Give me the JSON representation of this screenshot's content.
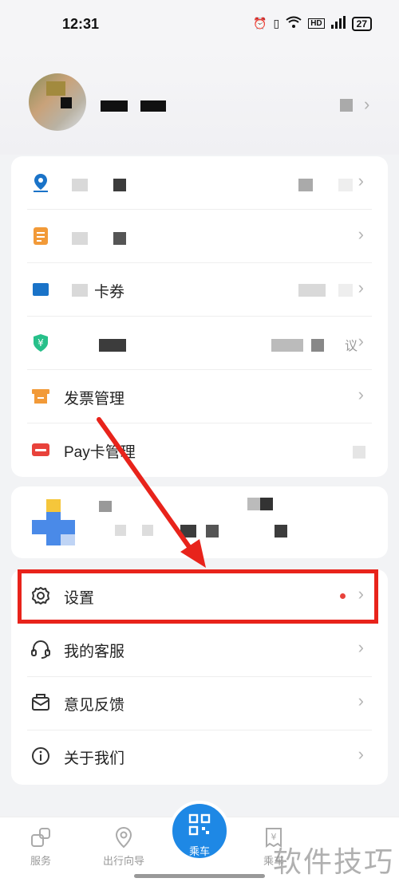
{
  "status_bar": {
    "time": "12:31",
    "battery": "27",
    "hd": "HD"
  },
  "menu_group_1": {
    "items": [
      {
        "label": "",
        "icon": "location-pin-icon",
        "color": "#1a73c8"
      },
      {
        "label": "",
        "icon": "document-icon",
        "color": "#f29a38"
      },
      {
        "label": "卡券",
        "icon": "coupon-icon",
        "color": "#1a73c8"
      },
      {
        "label": "",
        "icon": "yuan-shield-icon",
        "color": "#27c08a",
        "extra": "议"
      },
      {
        "label": "发票管理",
        "icon": "invoice-icon",
        "color": "#f29a38"
      },
      {
        "label": "Pay卡管理",
        "icon": "pay-card-icon",
        "color": "#e8423b"
      }
    ]
  },
  "menu_group_2": {
    "items": [
      {
        "label": "设置",
        "icon": "gear-icon",
        "has_dot": true
      },
      {
        "label": "我的客服",
        "icon": "headset-icon"
      },
      {
        "label": "意见反馈",
        "icon": "feedback-icon"
      },
      {
        "label": "关于我们",
        "icon": "info-icon"
      }
    ]
  },
  "tabbar": {
    "tabs": [
      {
        "label": "服务"
      },
      {
        "label": "出行向导"
      },
      {
        "label": "乘车"
      },
      {
        "label": "乘车"
      }
    ]
  },
  "watermark": "软件技巧",
  "chevron": "›"
}
